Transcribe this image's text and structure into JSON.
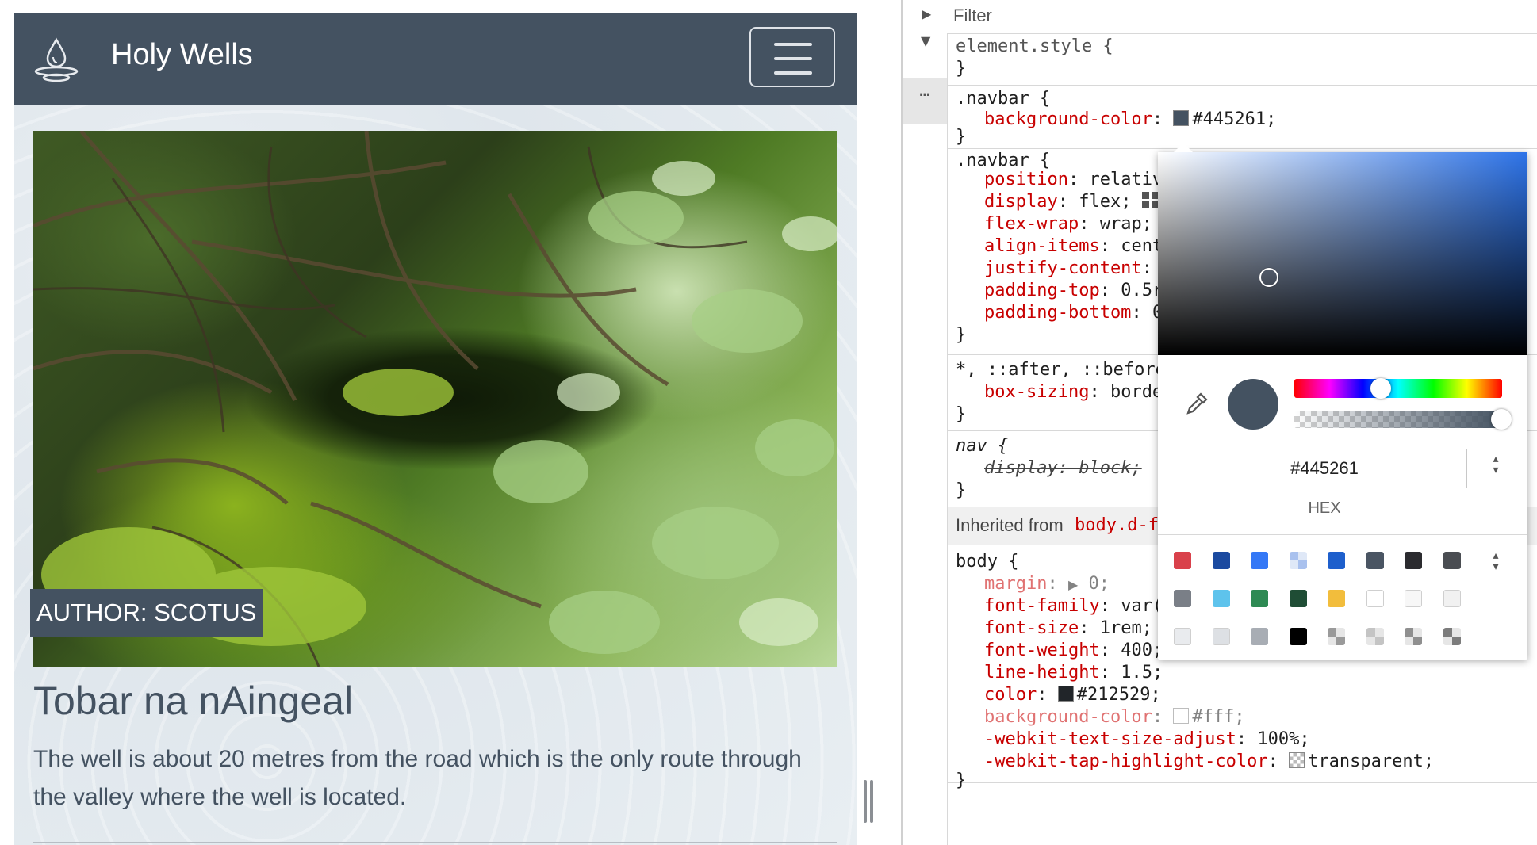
{
  "preview": {
    "brand": "Holy Wells",
    "author_badge": "AUTHOR: SCOTUS",
    "title": "Tobar na nAingeal",
    "description": "The well is about 20 metres from the road which is the only route through the valley where the well is located."
  },
  "devtools": {
    "filter_placeholder": "Filter",
    "rules": {
      "element_style": {
        "selector": "element.style {",
        "close": "}"
      },
      "navbar1": {
        "selector": ".navbar {",
        "prop": "background-color",
        "value": "#445261;",
        "color": "#445261",
        "close": "}"
      },
      "navbar2": {
        "selector": ".navbar {",
        "props": [
          {
            "name": "position",
            "value": "relativ"
          },
          {
            "name": "display",
            "value": "flex;"
          },
          {
            "name": "flex-wrap",
            "value": "wrap;"
          },
          {
            "name": "align-items",
            "value": "cent"
          },
          {
            "name": "justify-content",
            "value": ""
          },
          {
            "name": "padding-top",
            "value": "0.5r"
          },
          {
            "name": "padding-bottom",
            "value": "0"
          }
        ],
        "close": "}"
      },
      "universal": {
        "selector": "*, ::after, ::before",
        "prop": "box-sizing",
        "value": "borde",
        "close": "}"
      },
      "nav": {
        "selector": "nav {",
        "prop": "display: block;",
        "close": "}"
      },
      "inherited": {
        "label": "Inherited from",
        "selector": "body.d-f"
      },
      "body": {
        "selector": "body {",
        "props": [
          {
            "name": "margin",
            "value": "0;"
          },
          {
            "name": "font-family",
            "value": "var("
          },
          {
            "name": "font-size",
            "value": "1rem;"
          },
          {
            "name": "font-weight",
            "value": "400;"
          },
          {
            "name": "line-height",
            "value": "1.5;"
          },
          {
            "name": "color",
            "value": "#212529;"
          },
          {
            "name": "background-color",
            "value": "#fff;"
          },
          {
            "name": "-webkit-text-size-adjust",
            "value": "100%;"
          },
          {
            "name": "-webkit-tap-highlight-color",
            "value": "transparent;"
          }
        ],
        "close": "}"
      }
    },
    "color_picker": {
      "hex_value": "#445261",
      "format_label": "HEX",
      "current_color": "#445261",
      "swatches": [
        "#d9414b",
        "#1b4aa0",
        "#3478f6",
        "#a9c1ee",
        "#1e5fcc",
        "#4a5563",
        "#2b2b2f",
        "#4a4d52",
        "#7a7f87",
        "#5ec3ec",
        "#2e8a53",
        "#1f4d35",
        "#f2bd3c",
        "#ffffff",
        "#f7f7f7",
        "#f1f1f1",
        "#e9ebee",
        "#dde0e4",
        "#a8adb4",
        "#000000",
        "#9a9a9a",
        "#c4c4c4",
        "#8f8f8f",
        "#7c7c7c"
      ]
    }
  }
}
